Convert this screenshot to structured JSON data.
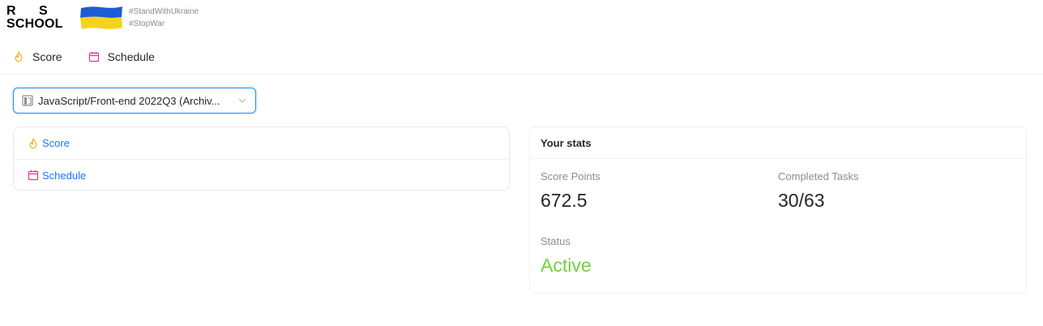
{
  "logo": {
    "r": "R",
    "s": "S",
    "school": "SCHOOL"
  },
  "tags": [
    "#StandWithUkraine",
    "#StopWar"
  ],
  "nav": [
    {
      "label": "Score",
      "icon": "fire-icon"
    },
    {
      "label": "Schedule",
      "icon": "calendar-icon"
    }
  ],
  "course_select": {
    "value": "JavaScript/Front-end 2022Q3 (Archiv...",
    "icon": "github-icon"
  },
  "links": [
    {
      "label": "Score",
      "icon": "fire-icon"
    },
    {
      "label": "Schedule",
      "icon": "calendar-icon"
    }
  ],
  "stats": {
    "title": "Your stats",
    "score_label": "Score Points",
    "score_value": "672.5",
    "tasks_label": "Completed Tasks",
    "tasks_value": "30/63",
    "status_label": "Status",
    "status_value": "Active"
  },
  "colors": {
    "fire": "#faad14",
    "calendar": "#eb2f96",
    "link": "#1677ff",
    "active": "#73d13d",
    "select_border": "#1890ff",
    "flag_blue": "#1e5bd6",
    "flag_yellow": "#f6d21a"
  }
}
